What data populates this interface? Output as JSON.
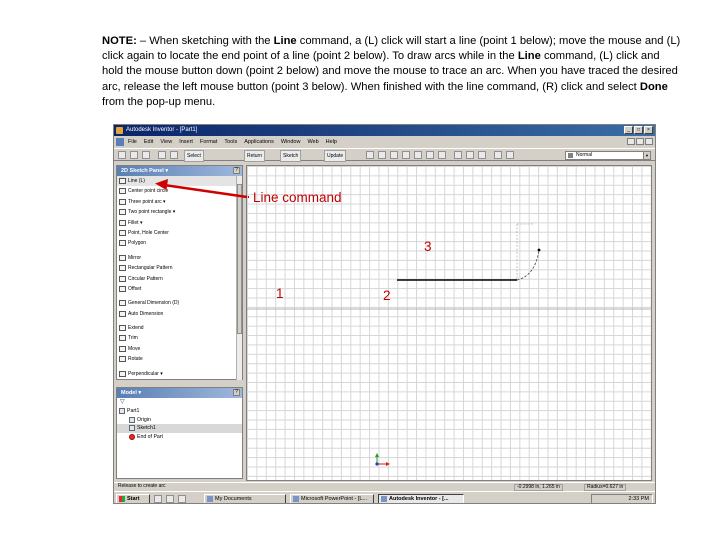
{
  "note": {
    "label": "NOTE:",
    "t1": " – When sketching with the ",
    "b1": "Line",
    "t2": " command, a (L) click will start a line (point 1 below); move the mouse and (L) click again to locate the end point of a line (point 2 below). To draw arcs while in the ",
    "b2": "Line",
    "t3": " command, (L) click and hold the mouse button down (point 2 below) and move the mouse to trace an arc. When you have traced the desired arc, release the left mouse button (point 3 below). When finished with the line command, (R) click and select ",
    "b3": "Done",
    "t4": " from the pop-up menu."
  },
  "app": {
    "title": "Autodesk Inventor - [Part1]",
    "menus": [
      "File",
      "Edit",
      "View",
      "Insert",
      "Format",
      "Tools",
      "Applications",
      "Window",
      "Web",
      "Help"
    ],
    "toolbar": {
      "select": "Select",
      "return": "Return",
      "sketch": "Sketch",
      "update": "Update",
      "style": "Normal"
    },
    "panel": {
      "title": "2D Sketch Panel ▾",
      "items": [
        {
          "label": "Line",
          "shortcut": "(L)"
        },
        {
          "label": "Center point circle"
        },
        {
          "label": "Three point arc ▾"
        },
        {
          "label": "Two point rectangle ▾"
        },
        {
          "label": "Fillet ▾"
        },
        {
          "label": "Point, Hole Center"
        },
        {
          "label": "Polygon"
        },
        {
          "label": "Mirror"
        },
        {
          "label": "Rectangular Pattern"
        },
        {
          "label": "Circular Pattern"
        },
        {
          "label": "Offset"
        },
        {
          "label": "General Dimension",
          "shortcut": "(D)"
        },
        {
          "label": "Auto Dimension"
        },
        {
          "label": "Extend"
        },
        {
          "label": "Trim"
        },
        {
          "label": "Move"
        },
        {
          "label": "Rotate"
        },
        {
          "label": "Perpendicular ▾"
        }
      ]
    },
    "browser": {
      "title": "Model ▾",
      "items": [
        "Part1",
        "Origin",
        "Sketch1",
        "End of Part"
      ]
    },
    "status": {
      "prompt": "Release to create arc",
      "coords": "-0.2998 in, 1.265 in",
      "radius": "Radius=0.627 in"
    },
    "taskbar": {
      "start": "Start",
      "tasks": [
        "My Documents",
        "Microsoft PowerPoint - [L...",
        "Autodesk Inventor - [..."
      ],
      "clock": "2:33 PM"
    }
  },
  "annotations": {
    "line_command": "Line command",
    "p1": "1",
    "p2": "2",
    "p3": "3",
    "arrow_color": "#d00000",
    "label_color": "#c00000"
  }
}
